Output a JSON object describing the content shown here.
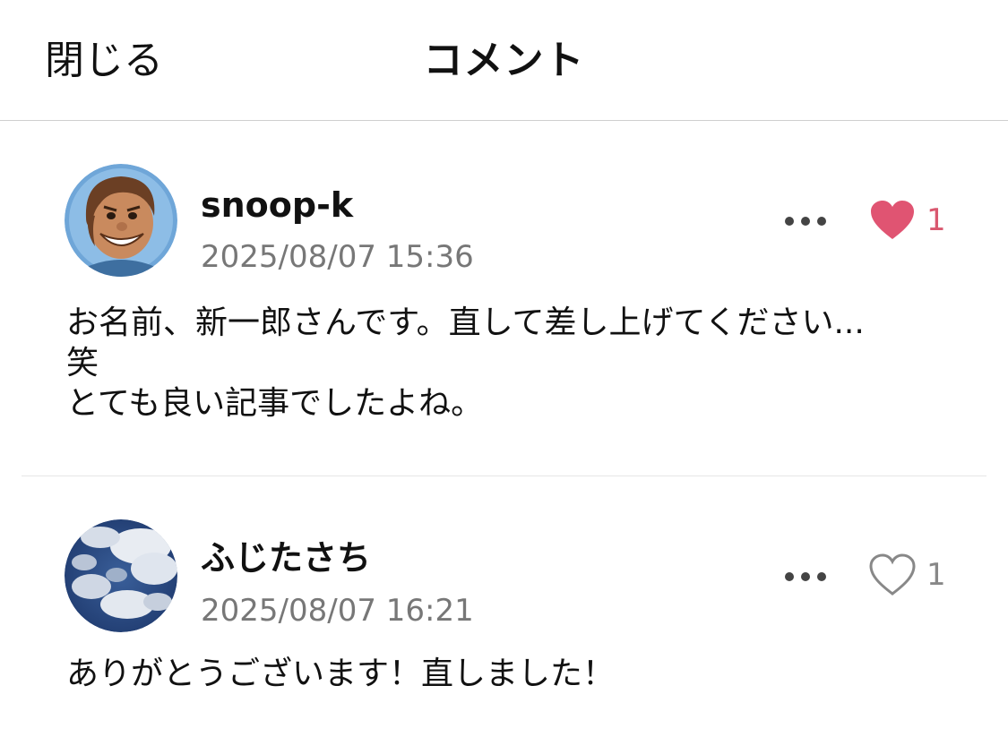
{
  "header": {
    "close_label": "閉じる",
    "title": "コメント"
  },
  "colors": {
    "liked_heart": "#e05472",
    "unliked_heart": "#888888",
    "timestamp": "#777777",
    "divider": "#e6e6e6"
  },
  "comments": [
    {
      "username": "snoop-k",
      "timestamp": "2025/08/07 15:36",
      "body": "お名前、新一郎さんです。直して差し上げてください...\n笑\nとても良い記事でしたよね。",
      "liked": true,
      "like_count": "1",
      "avatar_icon": "cartoon-character-avatar"
    },
    {
      "username": "ふじたさち",
      "timestamp": "2025/08/07 16:21",
      "body": "ありがとうございます！直しました！",
      "liked": false,
      "like_count": "1",
      "avatar_icon": "sky-clouds-avatar"
    }
  ],
  "icons": {
    "more": "more-dots-icon",
    "heart_filled": "heart-filled-icon",
    "heart_outline": "heart-outline-icon"
  }
}
